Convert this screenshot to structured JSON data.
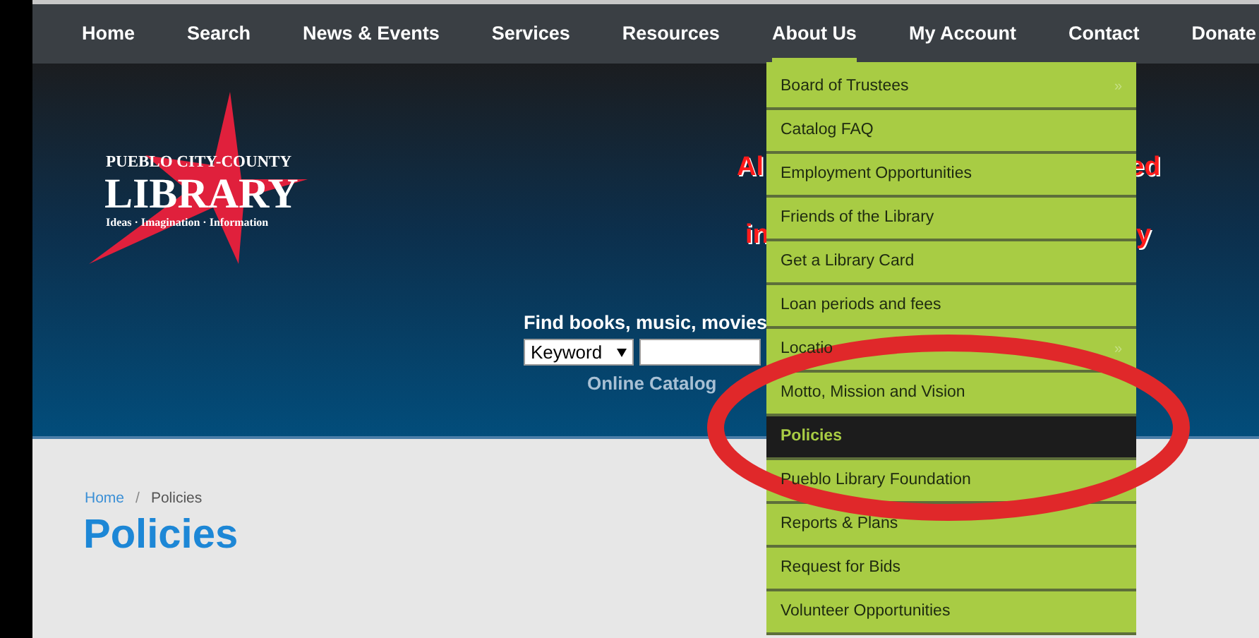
{
  "nav": [
    {
      "label": "Home",
      "selected": false
    },
    {
      "label": "Search",
      "selected": false
    },
    {
      "label": "News & Events",
      "selected": false
    },
    {
      "label": "Services",
      "selected": false
    },
    {
      "label": "Resources",
      "selected": false
    },
    {
      "label": "About Us",
      "selected": true
    },
    {
      "label": "My Account",
      "selected": false
    },
    {
      "label": "Contact",
      "selected": false
    },
    {
      "label": "Donate",
      "selected": false
    }
  ],
  "logo": {
    "top_line": "PUEBLO CITY-COUNTY",
    "name": "LIBRARY",
    "tagline": "Ideas · Imagination · Information"
  },
  "announcement_fragments": [
    {
      "left": "Al",
      "right": "ed"
    },
    {
      "left": "in",
      "right": "y"
    }
  ],
  "catalog_search": {
    "heading": "Find books, music, movies",
    "search_type": "Keyword",
    "link": "Online Catalog"
  },
  "dropdown": [
    {
      "label": "Board of Trustees",
      "selected": false,
      "arrow": "»"
    },
    {
      "label": "Catalog FAQ",
      "selected": false
    },
    {
      "label": "Employment Opportunities",
      "selected": false
    },
    {
      "label": "Friends of the Library",
      "selected": false
    },
    {
      "label": "Get a Library Card",
      "selected": false
    },
    {
      "label": "Loan periods and fees",
      "selected": false
    },
    {
      "label": "Locatio",
      "selected": false,
      "arrow": "»"
    },
    {
      "label": "Motto, Mission and Vision",
      "selected": false
    },
    {
      "label": "Policies",
      "selected": true
    },
    {
      "label": "Pueblo Library Foundation",
      "selected": false
    },
    {
      "label": "Reports & Plans",
      "selected": false
    },
    {
      "label": "Request for Bids",
      "selected": false
    },
    {
      "label": "Volunteer Opportunities",
      "selected": false
    }
  ],
  "breadcrumb": [
    {
      "label": "Home",
      "kind": "link"
    },
    {
      "label": "/",
      "kind": "separator"
    },
    {
      "label": "Policies",
      "kind": "current"
    }
  ],
  "page_title": "Policies"
}
